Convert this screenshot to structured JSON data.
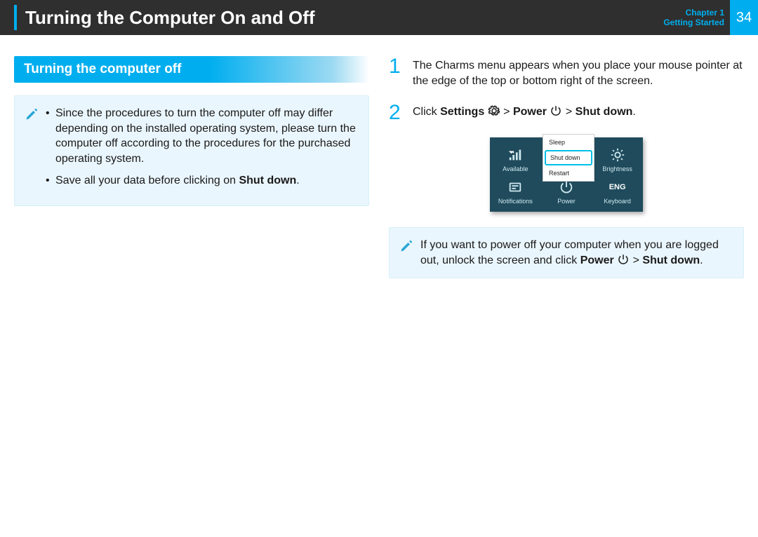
{
  "header": {
    "title": "Turning the Computer On and Off",
    "chapter_line1": "Chapter 1",
    "chapter_line2": "Getting Started",
    "page": "34"
  },
  "left": {
    "sub": "Turning the computer off",
    "bullet1a": "Since the procedures to turn the computer off may differ depending on the installed operating system, please turn the computer off according to the procedures for the purchased operating system.",
    "bullet2_pre": "Save all your data before clicking on ",
    "bullet2_bold": "Shut down",
    "bullet2_post": "."
  },
  "right": {
    "step1": "The Charms menu appears when you place your mouse pointer at the edge of the top or bottom right of the screen.",
    "step2": {
      "pre": "Click ",
      "settings": "Settings",
      "gt1": " > ",
      "power": "Power",
      "gt2": " > ",
      "shut": "Shut down",
      "post": "."
    },
    "note": {
      "pre": "If you want to power off your computer when you are logged out, unlock the screen and click ",
      "power": "Power",
      "gt": " > ",
      "shut": "Shut down",
      "post": "."
    }
  },
  "charms": {
    "popup": {
      "sleep": "Sleep",
      "shut": "Shut down",
      "restart": "Restart"
    },
    "row1": {
      "left": "Available",
      "right": "Brightness"
    },
    "row2": {
      "left": "Notifications",
      "mid": "Power",
      "right": "Keyboard",
      "eng": "ENG"
    }
  }
}
